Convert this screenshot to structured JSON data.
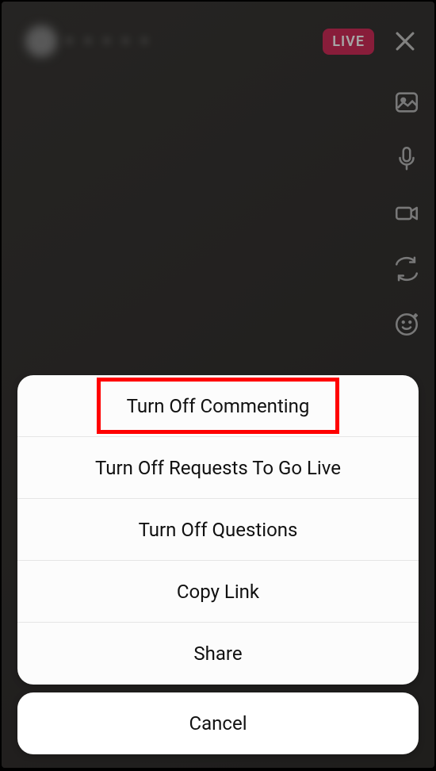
{
  "header": {
    "username": "• • • • •",
    "live_label": "LIVE"
  },
  "sheet": {
    "items": [
      "Turn Off Commenting",
      "Turn Off Requests To Go Live",
      "Turn Off Questions",
      "Copy Link",
      "Share"
    ],
    "cancel_label": "Cancel"
  }
}
